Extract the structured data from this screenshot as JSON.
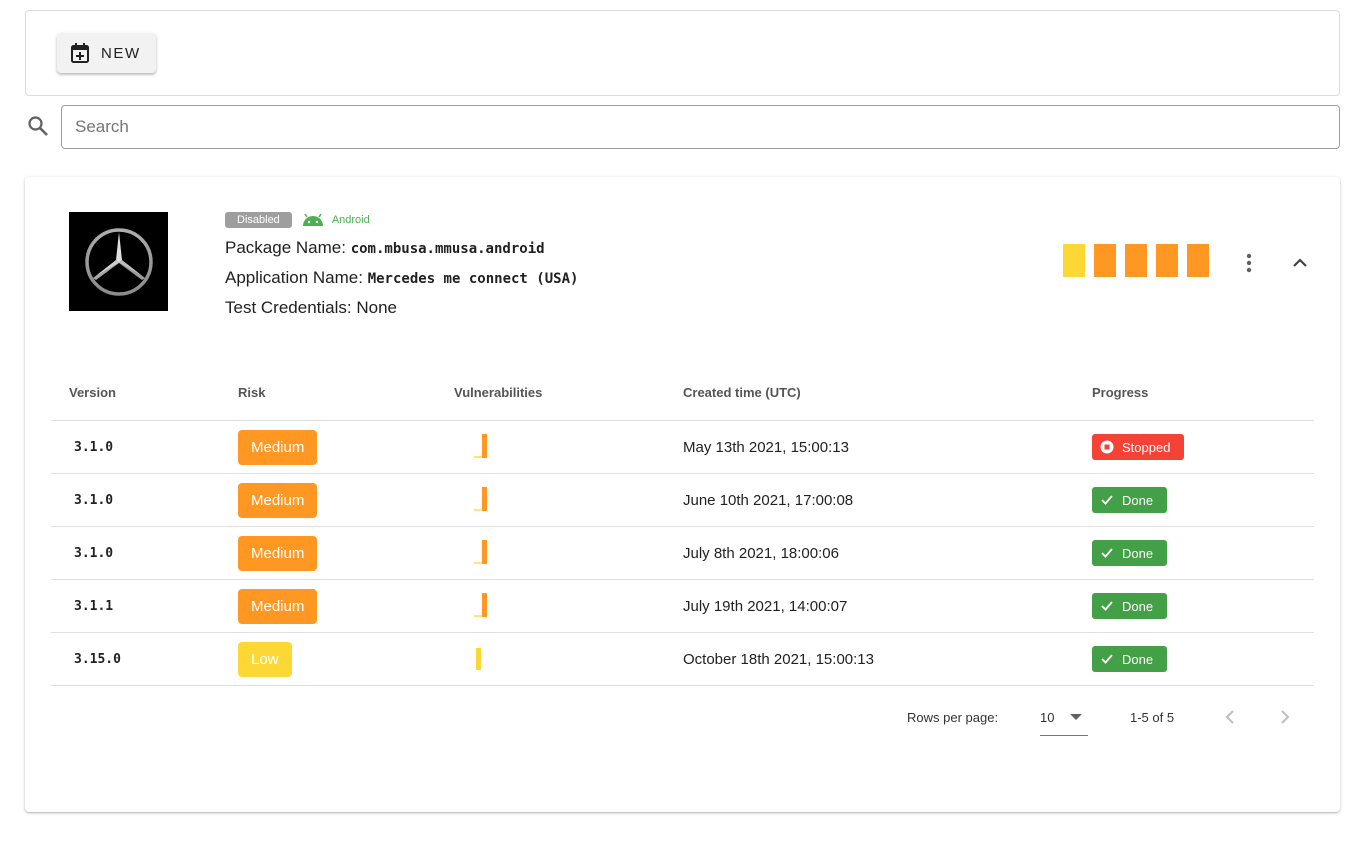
{
  "toolbar": {
    "new_label": "NEW",
    "new_icon": "calendar-plus-icon"
  },
  "search": {
    "placeholder": "Search",
    "value": "",
    "icon": "search-icon"
  },
  "app": {
    "status_badge": "Disabled",
    "platform": "Android",
    "package_label": "Package Name:",
    "package_value": "com.mbusa.mmusa.android",
    "appname_label": "Application Name:",
    "appname_value": "Mercedes me connect (USA)",
    "credentials_label": "Test Credentials:",
    "credentials_value": "None",
    "logo": "mercedes-star-logo",
    "severity_bar_colors": [
      "#fdd835",
      "#ff9822",
      "#ff9822",
      "#ff9822",
      "#ff9822"
    ]
  },
  "colors": {
    "medium": "#ff9822",
    "low": "#fdd835",
    "done": "#43a047",
    "stopped": "#f44336",
    "android": "#4caf50",
    "disabled": "#9e9e9e"
  },
  "table": {
    "headers": [
      "Version",
      "Risk",
      "Vulnerabilities",
      "Created time (UTC)",
      "Progress"
    ],
    "rows": [
      {
        "version": "3.1.0",
        "risk": "Medium",
        "created": "May 13th 2021, 15:00:13",
        "progress": "Stopped"
      },
      {
        "version": "3.1.0",
        "risk": "Medium",
        "created": "June 10th 2021, 17:00:08",
        "progress": "Done"
      },
      {
        "version": "3.1.0",
        "risk": "Medium",
        "created": "July 8th 2021, 18:00:06",
        "progress": "Done"
      },
      {
        "version": "3.1.1",
        "risk": "Medium",
        "created": "July 19th 2021, 14:00:07",
        "progress": "Done"
      },
      {
        "version": "3.15.0",
        "risk": "Low",
        "created": "October 18th 2021, 15:00:13",
        "progress": "Done"
      }
    ]
  },
  "pagination": {
    "rows_per_page_label": "Rows per page:",
    "rows_per_page_value": "10",
    "range_label": "1-5 of 5"
  }
}
